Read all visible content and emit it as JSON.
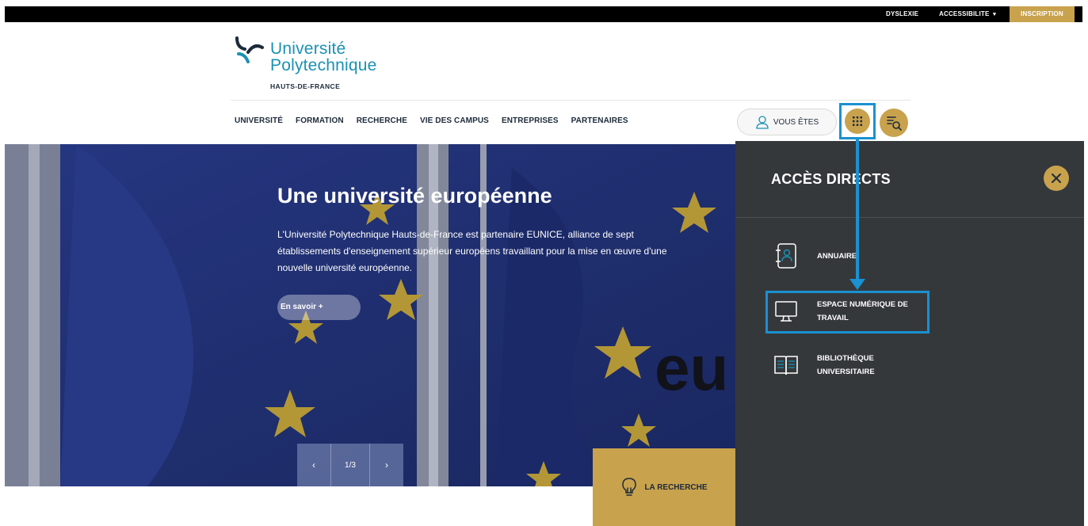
{
  "topbar": {
    "dyslexia": "DYSLEXIE",
    "accessibility": "ACCESSIBILITE",
    "register": "INSCRIPTION"
  },
  "logo": {
    "line1": "Université",
    "line2": "Polytechnique",
    "line3": "HAUTS-DE-FRANCE"
  },
  "nav": {
    "items": [
      "UNIVERSITÉ",
      "FORMATION",
      "RECHERCHE",
      "VIE DES CAMPUS",
      "ENTREPRISES",
      "PARTENAIRES"
    ],
    "vous_etes": "VOUS ÊTES"
  },
  "hero": {
    "title": "Une université européenne",
    "text": "L'Université Polytechnique Hauts-de-France est partenaire EUNICE, alliance de sept établissements d'enseignement supérieur européens travaillant pour la mise en œuvre d'une nouvelle université européenne.",
    "more": "En savoir +",
    "pager": "1/3"
  },
  "research_tile": "LA RECHERCHE",
  "panel": {
    "title": "ACCÈS DIRECTS",
    "items": [
      {
        "label": "ANNUAIRE",
        "icon": "directory-icon"
      },
      {
        "label": "ESPACE NUMÉRIQUE DE TRAVAIL",
        "icon": "monitor-icon"
      },
      {
        "label": "BIBLIOTHÈQUE UNIVERSITAIRE",
        "icon": "book-icon"
      }
    ]
  },
  "colors": {
    "accent": "#c9a24d",
    "brand_blue": "#1a91b4",
    "panel_bg": "#35383b",
    "highlight": "#1a91d1"
  }
}
